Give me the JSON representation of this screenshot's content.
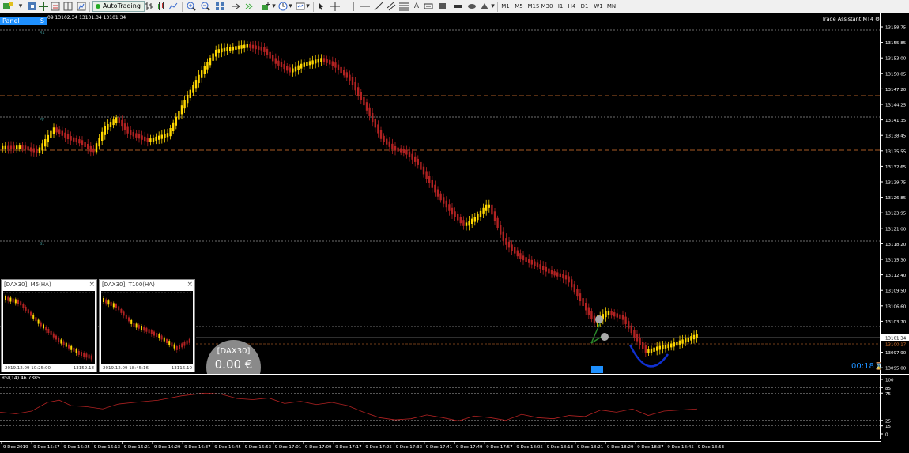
{
  "toolbar": {
    "autotrading_label": "AutoTrading",
    "timeframes": [
      "M1",
      "M5",
      "M15",
      "M30",
      "H1",
      "H4",
      "D1",
      "W1",
      "MN"
    ]
  },
  "chart": {
    "panel_label": "Panel",
    "panel_suffix": "S",
    "ohlc_text": "09 13102.34 13101.34 13101.34",
    "assistant_label": "Trade Assistant MT4",
    "price_labels": [
      "13158.75",
      "13155.85",
      "13153.00",
      "13150.05",
      "13147.20",
      "13144.25",
      "13141.35",
      "13138.45",
      "13135.55",
      "13132.65",
      "13129.75",
      "13126.85",
      "13123.95",
      "13121.00",
      "13118.20",
      "13115.30",
      "13112.40",
      "13109.50",
      "13106.60",
      "13103.70",
      "13100.80",
      "13097.90",
      "13095.00"
    ],
    "current_price": "13101.34",
    "second_price": "13100.17",
    "level_labels": [
      "R1",
      "PP",
      "S1"
    ],
    "countdown": "00:18",
    "colors": {
      "bull": "#ffd700",
      "bear": "#b22222",
      "level_dashed": "#dcdcdc",
      "level_orange": "#e07830",
      "rsi": "#b22222",
      "accent": "#1e90ff",
      "arc": "#1030d0"
    }
  },
  "mini_windows": [
    {
      "title": "[DAX30], M5(HA)",
      "footer_left": "2019.12.09 10:25:00",
      "footer_right": "13159.18"
    },
    {
      "title": "[DAX30], T100(HA)",
      "footer_left": "2019.12.09 18:45:16",
      "footer_right": "13116.10"
    }
  ],
  "mini_close_icon": "×",
  "equity": {
    "symbol": "[DAX30]",
    "amount": "0.00 €"
  },
  "rsi": {
    "label": "RSI(14) 46.7385",
    "levels": [
      "100",
      "85",
      "75",
      "25",
      "15",
      "0"
    ]
  },
  "time_labels": [
    "9 Dec 2019",
    "9 Dec 15:57",
    "9 Dec 16:05",
    "9 Dec 16:13",
    "9 Dec 16:21",
    "9 Dec 16:29",
    "9 Dec 16:37",
    "9 Dec 16:45",
    "9 Dec 16:53",
    "9 Dec 17:01",
    "9 Dec 17:09",
    "9 Dec 17:17",
    "9 Dec 17:25",
    "9 Dec 17:33",
    "9 Dec 17:41",
    "9 Dec 17:49",
    "9 Dec 17:57",
    "9 Dec 18:05",
    "9 Dec 18:13",
    "9 Dec 18:21",
    "9 Dec 18:29",
    "9 Dec 18:37",
    "9 Dec 18:45",
    "9 Dec 18:53"
  ]
}
